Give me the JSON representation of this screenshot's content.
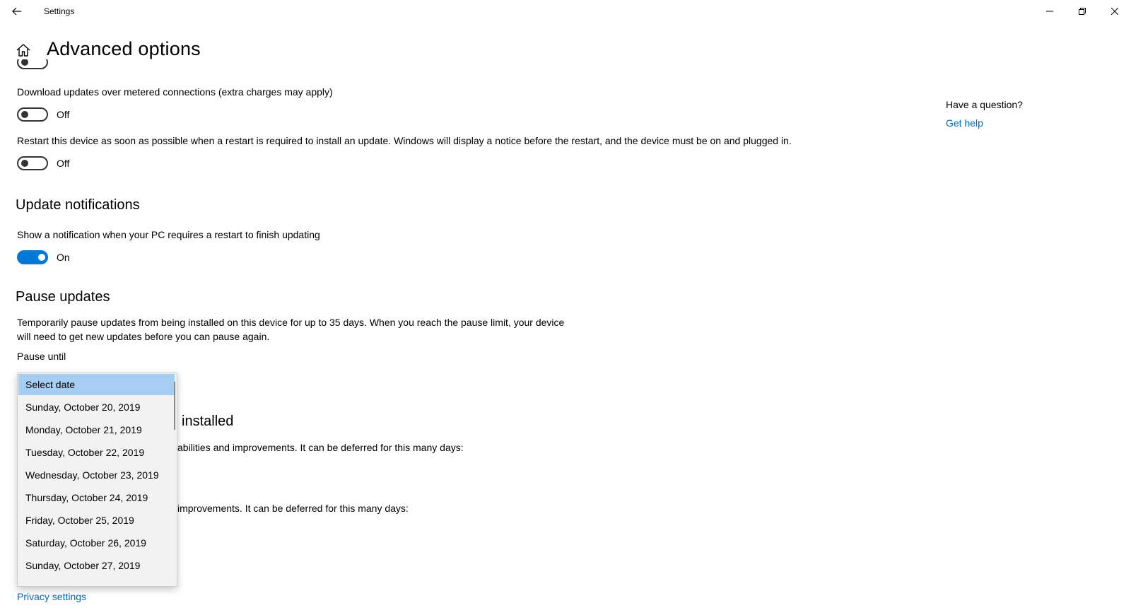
{
  "window": {
    "title": "Settings"
  },
  "header": {
    "title": "Advanced options"
  },
  "settings": {
    "partial_toggle_state": "Off",
    "metered": {
      "label": "Download updates over metered connections (extra charges may apply)",
      "state": "Off",
      "on": false
    },
    "restart": {
      "label": "Restart this device as soon as possible when a restart is required to install an update. Windows will display a notice before the restart, and the device must be on and plugged in.",
      "state": "Off",
      "on": false
    }
  },
  "update_notifications": {
    "heading": "Update notifications",
    "label": "Show a notification when your PC requires a restart to finish updating",
    "state": "On",
    "on": true
  },
  "pause_updates": {
    "heading": "Pause updates",
    "description": "Temporarily pause updates from being installed on this device for up to 35 days. When you reach the pause limit, your device will need to get new updates before you can pause again.",
    "pause_until_label": "Pause until",
    "options": [
      "Select date",
      "Sunday, October 20, 2019",
      "Monday, October 21, 2019",
      "Tuesday, October 22, 2019",
      "Wednesday, October 23, 2019",
      "Thursday, October 24, 2019",
      "Friday, October 25, 2019",
      "Saturday, October 26, 2019",
      "Sunday, October 27, 2019"
    ],
    "selected_index": 0
  },
  "obscured": {
    "heading_fragment": "installed",
    "feature_fragment": "abilities and improvements. It can be deferred for this many days:",
    "quality_fragment": "improvements. It can be deferred for this many days:"
  },
  "side_panel": {
    "question": "Have a question?",
    "help_link": "Get help"
  },
  "footer": {
    "privacy_link": "Privacy settings"
  },
  "colors": {
    "accent": "#0078d7",
    "link": "#0067b8",
    "selected_option": "#a6cdf2"
  }
}
